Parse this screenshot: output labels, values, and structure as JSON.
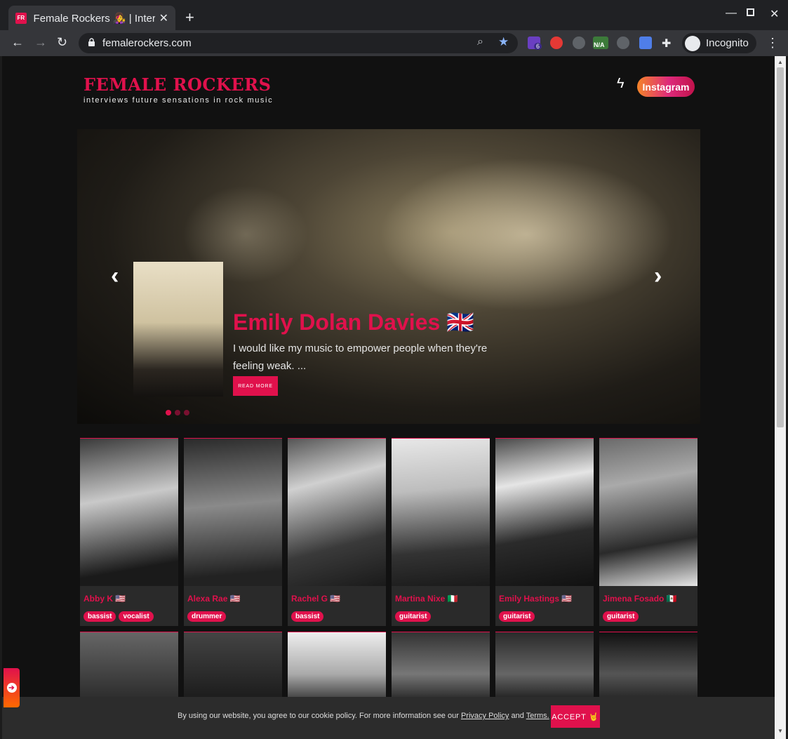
{
  "browser": {
    "tab_title": "Female Rockers 👩‍🎤 | Interviews",
    "tab_favicon": "FR",
    "url": "femalerockers.com",
    "incognito_label": "Incognito",
    "extension_badge": "6",
    "extension_na": "N/A"
  },
  "site": {
    "brand": "FEMALE ROCKERS",
    "tagline": "interviews future sensations in rock music",
    "instagram_label": "Instagram"
  },
  "hero": {
    "name": "Emily Dolan Davies 🇬🇧",
    "excerpt": "I would like my music to empower people when they're feeling weak. ...",
    "read_more": "READ MORE",
    "slide_count": 3,
    "active_slide": 1
  },
  "artists": [
    {
      "name": "Abby K 🇺🇸",
      "tags": [
        "bassist",
        "vocalist"
      ]
    },
    {
      "name": "Alexa Rae 🇺🇸",
      "tags": [
        "drummer"
      ]
    },
    {
      "name": "Rachel G 🇺🇸",
      "tags": [
        "bassist"
      ]
    },
    {
      "name": "Martina Nixe 🇮🇹",
      "tags": [
        "guitarist"
      ]
    },
    {
      "name": "Emily Hastings 🇺🇸",
      "tags": [
        "guitarist"
      ]
    },
    {
      "name": "Jimena Fosado 🇲🇽",
      "tags": [
        "guitarist"
      ]
    }
  ],
  "cookie": {
    "text_before": "By using our website, you agree to our cookie policy. For more information see our ",
    "privacy_link": "Privacy Policy",
    "and": " and ",
    "terms_link": "Terms.",
    "accept_label": "ACCEPT 🤘"
  },
  "colors": {
    "accent": "#e0114c",
    "page_bg": "#111111",
    "card_bg": "#2a2a2a"
  }
}
